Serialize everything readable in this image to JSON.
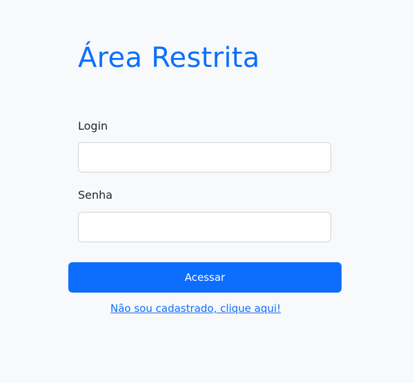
{
  "header": {
    "title": "Área Restrita"
  },
  "form": {
    "login_label": "Login",
    "login_value": "",
    "senha_label": "Senha",
    "senha_value": "",
    "submit_label": "Acessar",
    "register_link": "Não sou cadastrado, clique aqui!"
  },
  "colors": {
    "background": "#f8f9fa",
    "accent": "#0d6efd",
    "input_border": "#ced4da",
    "text": "#212529"
  }
}
